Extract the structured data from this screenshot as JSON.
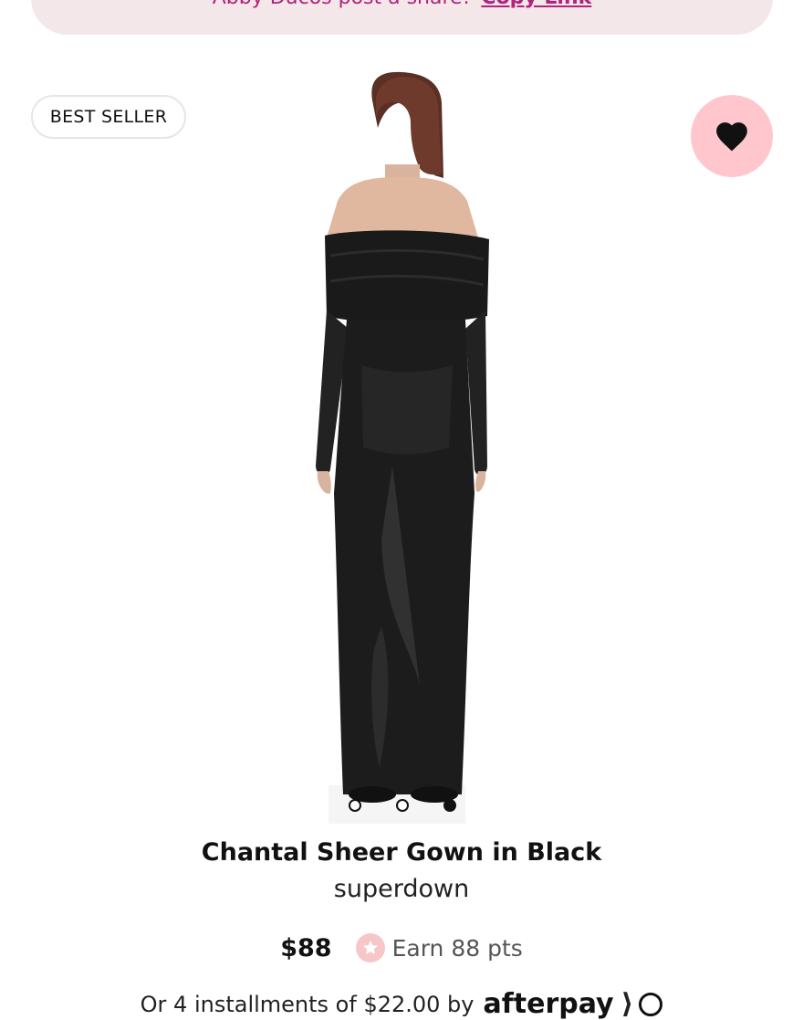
{
  "share_banner": {
    "text": "Abby Ducos post a share!",
    "link_label": "Copy Link"
  },
  "badge": {
    "label": "BEST SELLER"
  },
  "favorite": {
    "icon": "heart-icon",
    "active": true,
    "color": "#111111",
    "background": "#ffc6cd"
  },
  "product_image": {
    "icon": "product-photo"
  },
  "carousel": {
    "count": 3,
    "active_index": 2
  },
  "product": {
    "name": "Chantal Sheer Gown in Black",
    "brand": "superdown",
    "price": "$88",
    "points_label": "Earn 88 pts",
    "points_icon": "star-icon",
    "installments_text": "Or 4 installments of $22.00 by",
    "installments_provider": "afterpay"
  },
  "colors": {
    "accent": "#b2237a",
    "banner_bg": "#f3e7ea",
    "points_badge": "#f6c7c9"
  }
}
